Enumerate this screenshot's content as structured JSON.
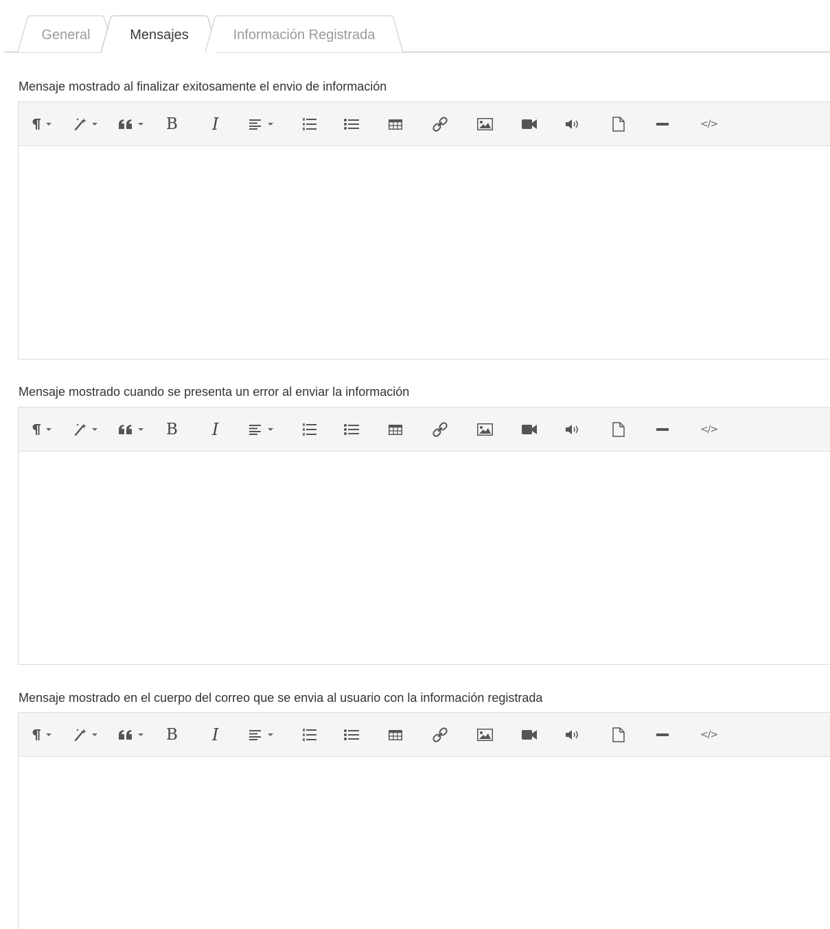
{
  "tabs": [
    {
      "label": "General",
      "active": false
    },
    {
      "label": "Mensajes",
      "active": true
    },
    {
      "label": "Información Registrada",
      "active": false
    }
  ],
  "toolbar_buttons": [
    {
      "name": "paragraph-style",
      "icon": "pilcrow-icon",
      "dropdown": true
    },
    {
      "name": "font-style",
      "icon": "magic-wand-icon",
      "dropdown": true
    },
    {
      "name": "blockquote",
      "icon": "quote-icon",
      "dropdown": true
    },
    {
      "name": "bold",
      "icon": "bold-icon",
      "dropdown": false
    },
    {
      "name": "italic",
      "icon": "italic-icon",
      "dropdown": false
    },
    {
      "name": "align",
      "icon": "align-left-icon",
      "dropdown": true
    },
    {
      "name": "ordered-list",
      "icon": "ordered-list-icon",
      "dropdown": false
    },
    {
      "name": "unordered-list",
      "icon": "unordered-list-icon",
      "dropdown": false
    },
    {
      "name": "table",
      "icon": "table-icon",
      "dropdown": false
    },
    {
      "name": "link",
      "icon": "link-icon",
      "dropdown": false
    },
    {
      "name": "image",
      "icon": "image-icon",
      "dropdown": false
    },
    {
      "name": "video",
      "icon": "video-camera-icon",
      "dropdown": false
    },
    {
      "name": "audio",
      "icon": "volume-icon",
      "dropdown": false
    },
    {
      "name": "file",
      "icon": "file-icon",
      "dropdown": false
    },
    {
      "name": "horizontal-rule",
      "icon": "minus-icon",
      "dropdown": false
    },
    {
      "name": "code-view",
      "icon": "code-icon",
      "dropdown": false
    }
  ],
  "toolbar_text": {
    "bold": "B",
    "italic": "I",
    "code": "</>"
  },
  "sections": [
    {
      "label": "Mensaje mostrado al finalizar exitosamente el envio de información",
      "content": ""
    },
    {
      "label": "Mensaje mostrado cuando se presenta un error al enviar la información",
      "content": ""
    },
    {
      "label": "Mensaje mostrado en el cuerpo del correo que se envia al usuario con la información registrada",
      "content": ""
    }
  ],
  "colors": {
    "border": "#dcdcdc",
    "toolbar_bg": "#f5f5f5",
    "text": "#333333",
    "inactive_tab": "#9a9a9a"
  }
}
